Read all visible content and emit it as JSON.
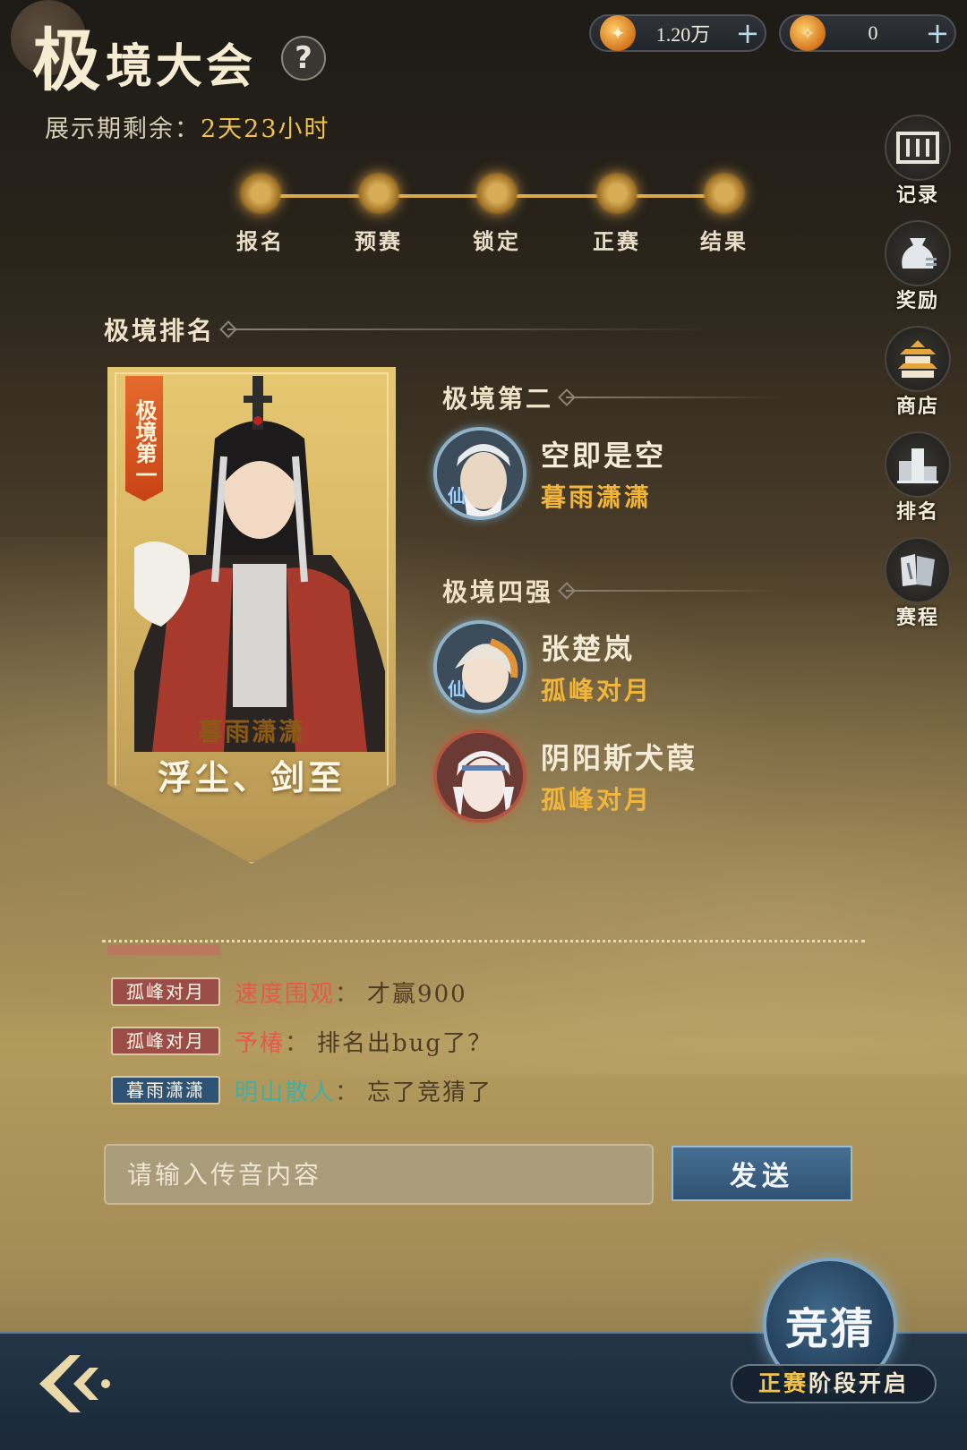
{
  "header": {
    "title_big": "极",
    "title_rest": "境大会",
    "help_label": "?",
    "countdown_label": "展示期剩余：",
    "countdown_value": "2天23小时"
  },
  "currency": [
    {
      "icon": "flame-coin-icon",
      "amount": "1.20万",
      "plus": "+"
    },
    {
      "icon": "flame-token-icon",
      "amount": "0",
      "plus": "+"
    }
  ],
  "stages": [
    "报名",
    "预赛",
    "锁定",
    "正赛",
    "结果"
  ],
  "side_menu": [
    {
      "icon": "record-icon",
      "label": "记录"
    },
    {
      "icon": "reward-icon",
      "label": "奖励"
    },
    {
      "icon": "shop-icon",
      "label": "商店"
    },
    {
      "icon": "ranking-icon",
      "label": "排名"
    },
    {
      "icon": "schedule-icon",
      "label": "赛程"
    }
  ],
  "ranking": {
    "heading": "极境排名",
    "first": {
      "tag": "极境第一",
      "guild": "暮雨潇潇",
      "name": "浮尘、剑至"
    },
    "second_heading": "极境第二",
    "second": {
      "name": "空即是空",
      "guild": "暮雨潇潇",
      "avatar_mark": "仙"
    },
    "top4_heading": "极境四强",
    "top4": [
      {
        "name": "张楚岚",
        "guild": "孤峰对月",
        "avatar_mark": "仙"
      },
      {
        "name": "阴阳斯犬葭",
        "guild": "孤峰对月",
        "avatar_mark": ""
      }
    ]
  },
  "chat": {
    "messages": [
      {
        "tag": "孤峰对月",
        "user": "速度围观",
        "colon": "：",
        "text": "才赢900"
      },
      {
        "tag": "孤峰对月",
        "user": "予椿",
        "colon": "：",
        "text": "排名出bug了？"
      },
      {
        "tag": "暮雨潇潇",
        "user": "明山散人",
        "colon": "：",
        "text": "忘了竞猜了"
      }
    ],
    "input_placeholder": "请输入传音内容",
    "send_label": "发送"
  },
  "guess": {
    "label": "竞猜",
    "note_highlight": "正赛",
    "note_rest": "阶段开启"
  },
  "colors": {
    "accent_gold": "#f0c24a",
    "guild_red": "#9b4d48",
    "guild_blue": "#2f5375",
    "bottom_bar": "#223547"
  }
}
